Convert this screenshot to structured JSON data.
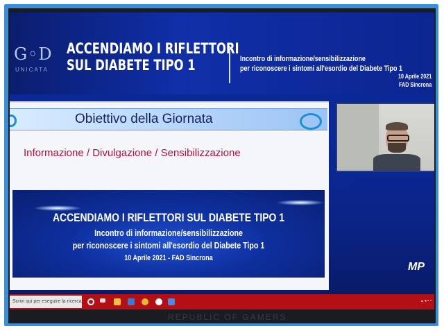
{
  "header": {
    "logo_text": "G◦D",
    "logo_sub": "UNICATA",
    "title_line1": "ACCENDIAMO I RIFLETTORI",
    "title_line2": "SUL DIABETE TIPO 1",
    "subtitle_line1": "Incontro di informazione/sensibilizzazione",
    "subtitle_line2": "per riconoscere i sintomi all'esordio del Diabete Tipo 1",
    "date": "10 Aprile 2021",
    "mode": "FAD Sincrona"
  },
  "slide": {
    "title": "Obiettivo della Giornata",
    "body": "Informazione / Divulgazione / Sensibilizzazione",
    "banner_line1": "ACCENDIAMO I RIFLETTORI  SUL DIABETE TIPO 1",
    "banner_line2": "Incontro di informazione/sensibilizzazione",
    "banner_line3": "per riconoscere i sintomi all'esordio del Diabete Tipo 1",
    "banner_line4": "10 Aprile 2021 - FAD Sincrona"
  },
  "corner_logo": "MP",
  "taskbar": {
    "search_placeholder": "Scrivi qui per eseguire la ricerca",
    "icons": [
      "search-icon",
      "task-view-icon",
      "file-explorer-icon",
      "document-icon",
      "chrome-icon",
      "settings-icon",
      "app-icon"
    ],
    "colors": {
      "bar": "#b30f14"
    }
  },
  "bezel_text": "REPUBLIC OF GAMERS"
}
